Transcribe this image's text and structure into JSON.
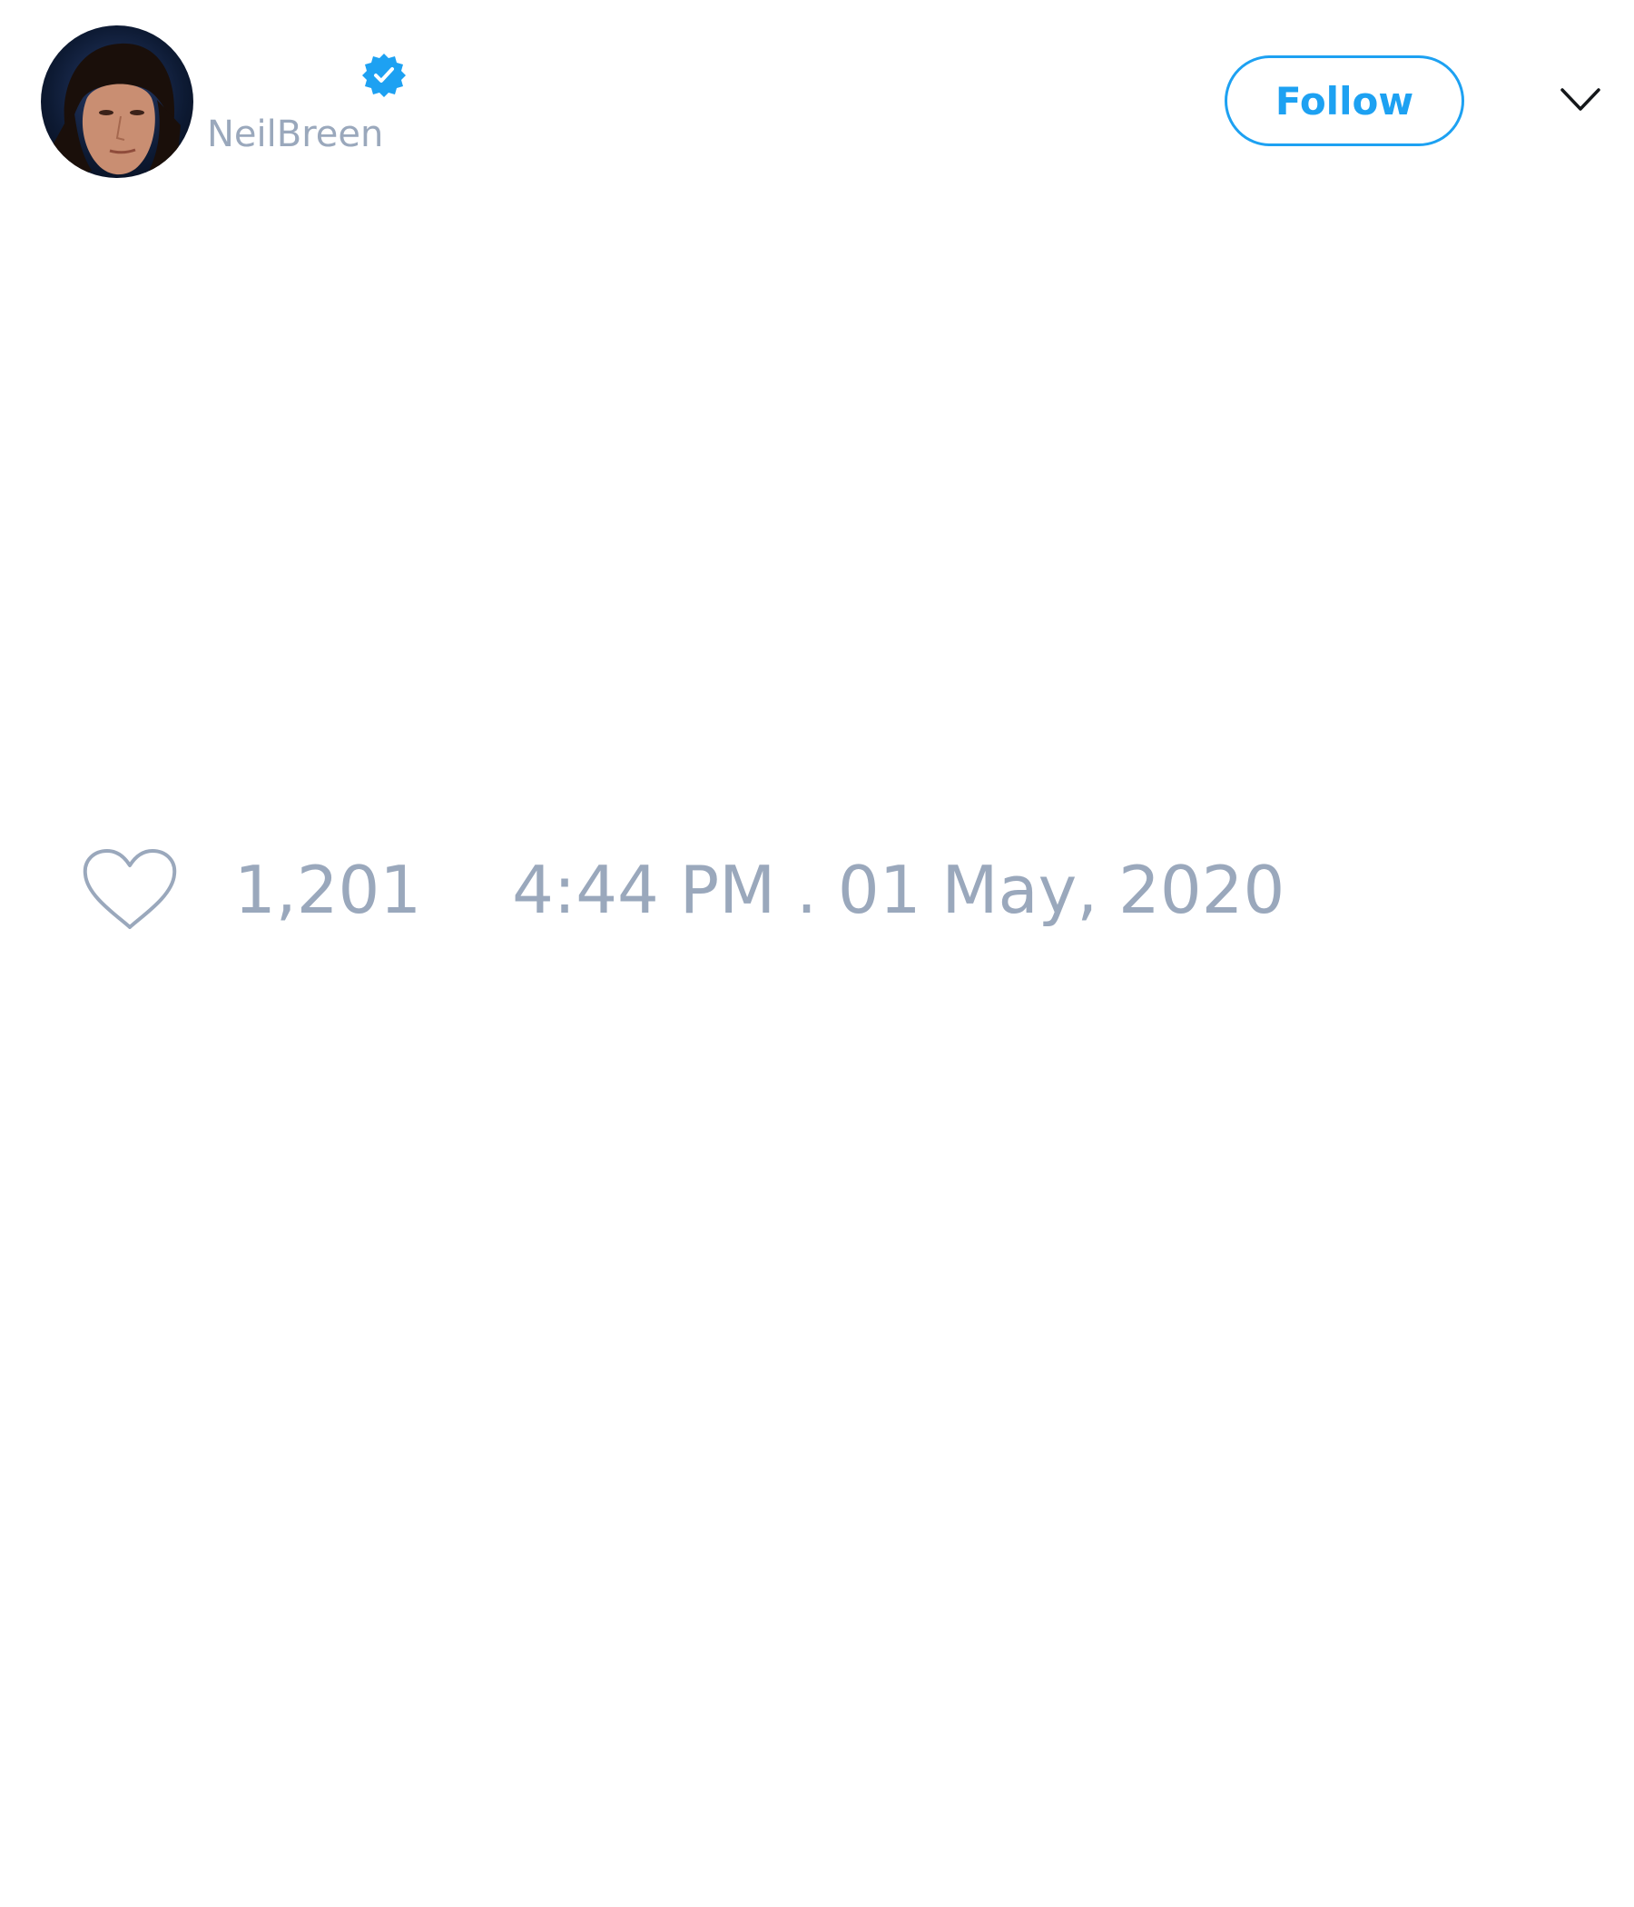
{
  "tweet": {
    "author": {
      "display_name": "",
      "handle": "NeilBreen",
      "verified": true,
      "avatar_icon": "profile-photo"
    },
    "follow_button_label": "Follow",
    "menu_icon": "chevron-down-icon",
    "text": "",
    "like_icon": "heart-outline-icon",
    "likes": "1,201",
    "timestamp": "4:44 PM . 01 May, 2020"
  },
  "colors": {
    "accent": "#1da1f2",
    "muted_text": "#9aa8bc",
    "chevron": "#14171a"
  }
}
